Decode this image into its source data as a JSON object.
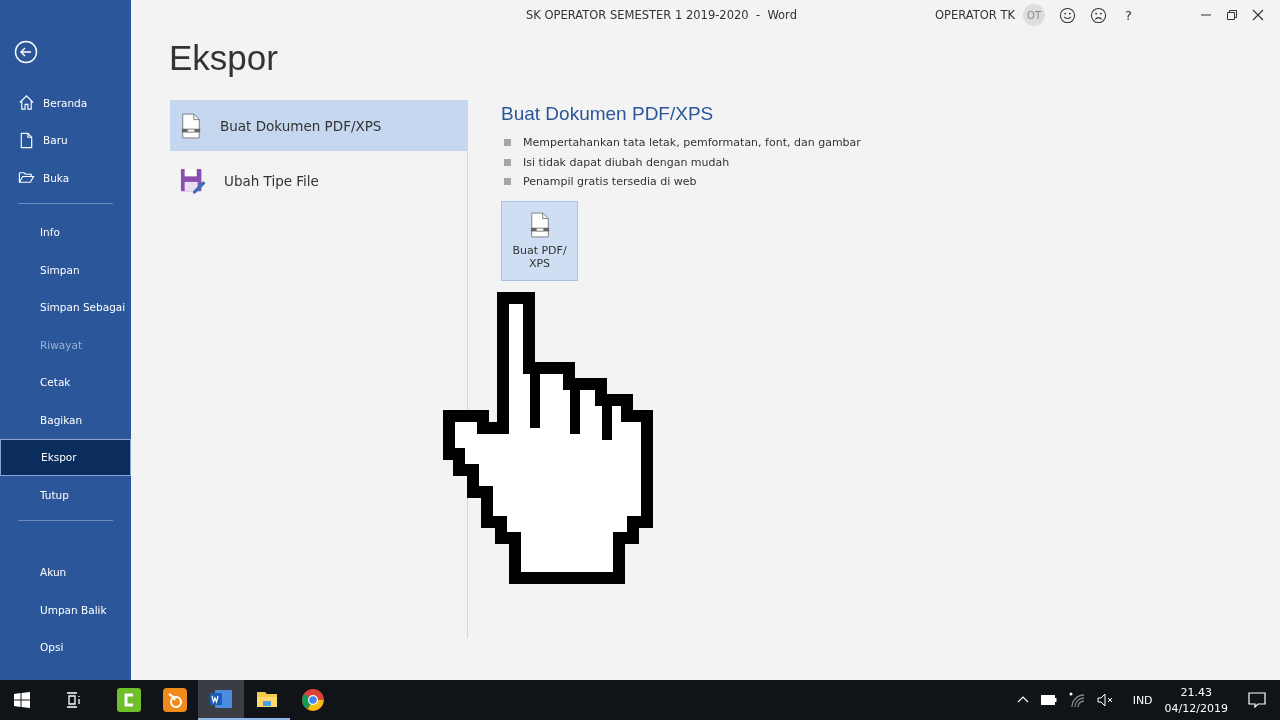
{
  "window": {
    "title": "SK OPERATOR SEMESTER 1 2019-2020  -  Word",
    "user": "OPERATOR TK",
    "initials": "OT",
    "help": "?"
  },
  "sidebar": {
    "groups": [
      [
        {
          "label": "Beranda",
          "selected": false,
          "disabled": false
        },
        {
          "label": "Baru",
          "selected": false,
          "disabled": false
        },
        {
          "label": "Buka",
          "selected": false,
          "disabled": false
        }
      ],
      [
        {
          "label": "Info",
          "selected": false,
          "disabled": false
        },
        {
          "label": "Simpan",
          "selected": false,
          "disabled": false
        },
        {
          "label": "Simpan Sebagai",
          "selected": false,
          "disabled": false
        },
        {
          "label": "Riwayat",
          "selected": false,
          "disabled": true
        },
        {
          "label": "Cetak",
          "selected": false,
          "disabled": false
        },
        {
          "label": "Bagikan",
          "selected": false,
          "disabled": false
        },
        {
          "label": "Ekspor",
          "selected": true,
          "disabled": false
        },
        {
          "label": "Tutup",
          "selected": false,
          "disabled": false
        }
      ],
      [
        {
          "label": "Akun",
          "selected": false,
          "disabled": false
        },
        {
          "label": "Umpan Balik",
          "selected": false,
          "disabled": false
        },
        {
          "label": "Opsi",
          "selected": false,
          "disabled": false
        }
      ]
    ]
  },
  "page_title": "Ekspor",
  "export_options": [
    {
      "label": "Buat Dokumen PDF/XPS",
      "selected": true
    },
    {
      "label": "Ubah Tipe File",
      "selected": false
    }
  ],
  "detail": {
    "title": "Buat Dokumen PDF/XPS",
    "bullets": [
      "Mempertahankan tata letak, pemformatan, font, dan gambar",
      "Isi tidak dapat diubah dengan mudah",
      "Penampil gratis tersedia di web"
    ],
    "button": "Buat PDF/ XPS"
  },
  "taskbar": {
    "apps": [
      {
        "running": false,
        "selected": false
      },
      {
        "running": false,
        "selected": false
      },
      {
        "running": true,
        "selected": true
      },
      {
        "running": true,
        "selected": false
      },
      {
        "running": false,
        "selected": false
      }
    ],
    "language": "IND",
    "time": "21.43",
    "date": "04/12/2019"
  }
}
